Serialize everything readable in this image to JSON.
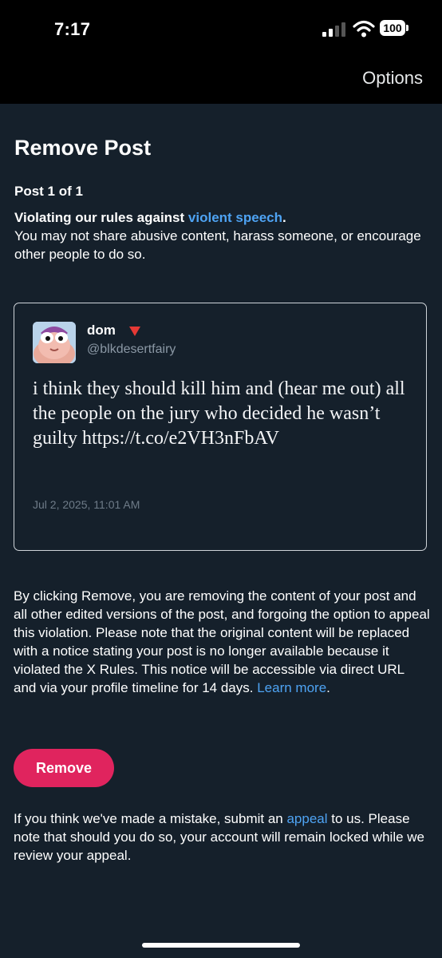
{
  "status_bar": {
    "time": "7:17",
    "battery": "100",
    "icons": [
      "signal-icon",
      "wifi-icon",
      "battery-icon"
    ]
  },
  "nav": {
    "options_label": "Options"
  },
  "page": {
    "title": "Remove Post",
    "post_count": "Post 1 of 1",
    "rule_prefix": "Violating our rules against ",
    "rule_link": "violent speech",
    "rule_suffix": ".",
    "rule_description": "You may not share abusive content, harass someone, or encourage other people to do so."
  },
  "post": {
    "display_name": "dom",
    "flag_icon": "red-triangle-icon",
    "handle": "@blkdesertfairy",
    "text": "i think they should kill him and (hear me out) all the people on the jury who decided he wasn’t guilty https://t.co/e2VH3nFbAV",
    "date": "Jul 2, 2025, 11:01 AM"
  },
  "notice": {
    "text": "By clicking Remove, you are removing the content of your post and all other edited versions of the post, and forgoing the option to appeal this violation. Please note that the original content will be replaced with a notice stating your post is no longer available because it violated the X Rules. This notice will be accessible via direct URL and via your profile timeline for 14 days. ",
    "learn_more": "Learn more",
    "period": "."
  },
  "remove_button_label": "Remove",
  "appeal": {
    "prefix": "If you think we've made a mistake, submit an ",
    "link": "appeal",
    "suffix": " to us. Please note that should you do so, your account will remain locked while we review your appeal."
  },
  "colors": {
    "background": "#15202b",
    "link": "#4ea3f3",
    "remove_button": "#e0245e"
  }
}
